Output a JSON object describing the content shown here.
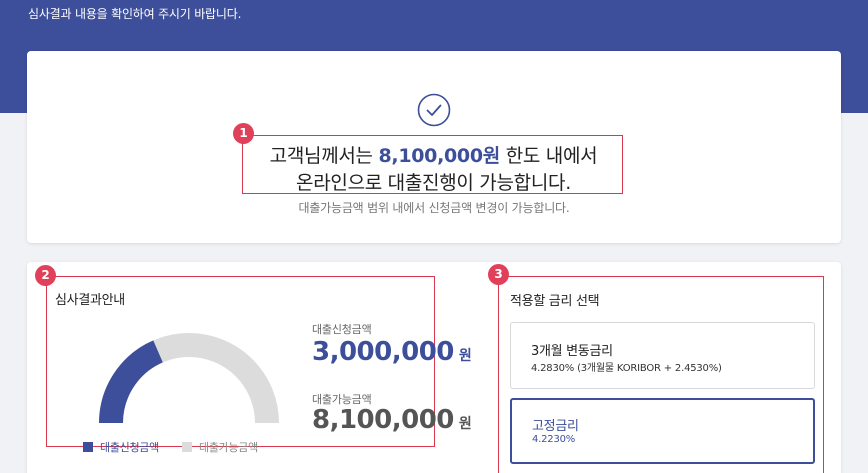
{
  "header": {
    "message": "심사결과 내용을 확인하여 주시기 바랍니다."
  },
  "result": {
    "line1_prefix": "고객님께서는 ",
    "limit_amount": "8,100,000원",
    "line1_suffix": " 한도 내에서",
    "line2": "온라인으로 대출진행이 가능합니다.",
    "subtitle": "대출가능금액 범위 내에서 신청금액 변경이 가능합니다."
  },
  "badges": [
    "1",
    "2",
    "3"
  ],
  "summary": {
    "title": "심사결과안내",
    "gauge": {
      "applied_fraction": 0.37,
      "applied_color": "#3d4e9a",
      "available_color": "#dcdcdc"
    },
    "legend": {
      "applied": "대출신청금액",
      "available": "대출가능금액"
    },
    "applied": {
      "label": "대출신청금액",
      "value": "3,000,000",
      "unit": "원"
    },
    "available": {
      "label": "대출가능금액",
      "value": "8,100,000",
      "unit": "원"
    }
  },
  "rates": {
    "title": "적용할 금리 선택",
    "options": [
      {
        "name": "3개월 변동금리",
        "detail": "4.2830% (3개월물 KORIBOR + 2.4530%)"
      },
      {
        "name": "고정금리",
        "detail": "4.2230%"
      }
    ]
  },
  "colors": {
    "brand": "#3d4e9a",
    "badge": "#e0405a",
    "highlight_border": "#d8394f"
  },
  "icons": {
    "check": "check-circle-icon"
  }
}
